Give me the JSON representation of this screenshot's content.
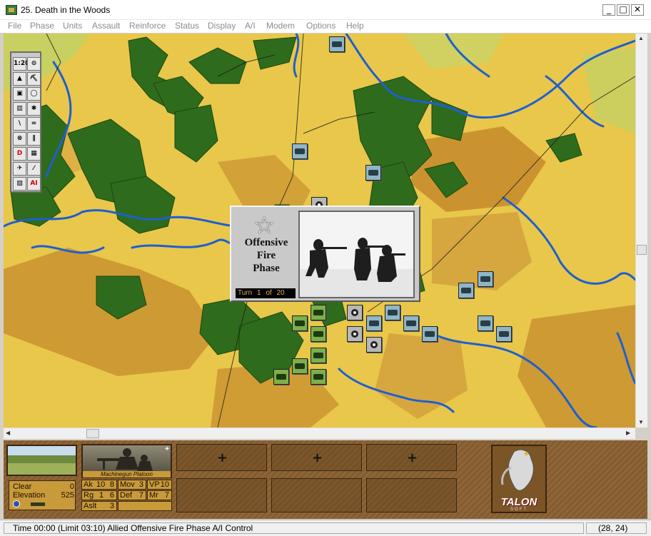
{
  "window": {
    "title": "25. Death in the Woods",
    "min": "_",
    "max": "□",
    "close": "✕"
  },
  "menu": [
    "File",
    "Phase",
    "Units",
    "Assault",
    "Reinforce",
    "Status",
    "Display",
    "A/I",
    "Modem",
    "Options",
    "Help"
  ],
  "palette": {
    "tools": [
      "1:20",
      "⊙",
      "▲",
      "⛏",
      "▣",
      "◯",
      "▥",
      "✱",
      "\\",
      "∞",
      "⊗",
      "‖",
      "D",
      "▦",
      "✈",
      "⁄",
      "▧",
      "AI"
    ]
  },
  "phase_dialog": {
    "title_line1": "Offensive",
    "title_line2": "Fire",
    "title_line3": "Phase",
    "turn_label": "Turn",
    "turn_current": "1",
    "turn_of": "of",
    "turn_total": "20"
  },
  "terrain_info": {
    "terrain": "Clear",
    "terrain_value": "0",
    "elevation_label": "Elevation",
    "elevation": "525"
  },
  "unit_card": {
    "name": "Machinegun Platoon",
    "plus": "+"
  },
  "unit_stats": {
    "ak_label": "Ak",
    "ak_1": "10",
    "ak_2": "8",
    "mov_label": "Mov",
    "mov": "3",
    "vp_label": "VP",
    "vp": "10",
    "rg_label": "Rg",
    "rg_1": "1",
    "rg_2": "6",
    "def_label": "Def",
    "def": "7",
    "mr_label": "Mr",
    "mr": "7",
    "aslt_label": "Aslt",
    "aslt": "3"
  },
  "slots": {
    "cross": "+"
  },
  "brand": {
    "name": "TALON",
    "sub": "SOFT"
  },
  "status": {
    "message": "Time 00:00 (Limit 03:10) Allied Offensive Fire Phase A/I Control",
    "coords": "(28, 24)"
  },
  "colors": {
    "clear": "#e8c74a",
    "high_ground": "#c9922f",
    "woods": "#2f6b1c",
    "river": "#1f5fd0",
    "allied_counter": "#8fb6c6",
    "axis_counter": "#7bb04a"
  }
}
